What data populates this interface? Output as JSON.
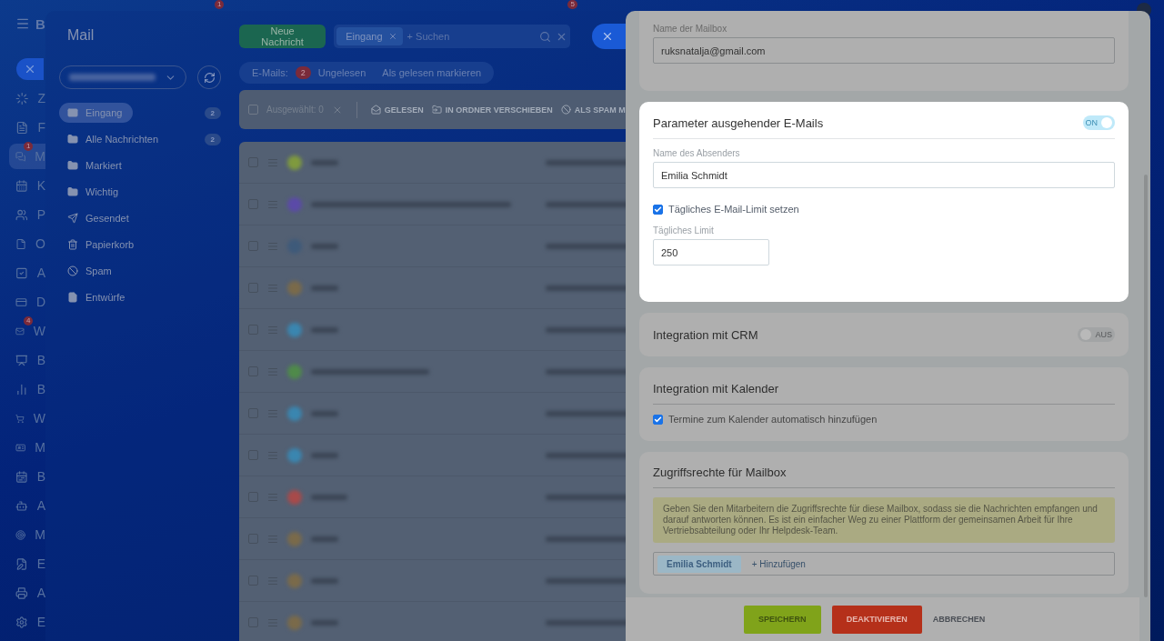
{
  "topbar": {
    "badges": [
      "1",
      "5"
    ]
  },
  "rail": {
    "brand": "B",
    "items": [
      {
        "label": "Z",
        "selected": false
      },
      {
        "label": "F",
        "selected": false
      },
      {
        "label": "M",
        "selected": true,
        "badge": "1"
      },
      {
        "label": "K",
        "selected": false
      },
      {
        "label": "P",
        "selected": false
      },
      {
        "label": "O",
        "selected": false
      },
      {
        "label": "A",
        "selected": false
      },
      {
        "label": "D",
        "selected": false
      },
      {
        "label": "W",
        "selected": false,
        "badge": "4"
      },
      {
        "label": "B",
        "selected": false
      },
      {
        "label": "B",
        "selected": false
      },
      {
        "label": "W",
        "selected": false
      },
      {
        "label": "M",
        "selected": false
      },
      {
        "label": "B",
        "selected": false
      },
      {
        "label": "A",
        "selected": false
      },
      {
        "label": "M",
        "selected": false
      },
      {
        "label": "E",
        "selected": false
      },
      {
        "label": "A",
        "selected": false
      },
      {
        "label": "E",
        "selected": false
      }
    ]
  },
  "mail": {
    "title": "Mail",
    "folders": [
      {
        "label": "Eingang",
        "count": "2",
        "selected": true
      },
      {
        "label": "Alle Nachrichten",
        "count": "2",
        "selected": false
      },
      {
        "label": "Markiert",
        "selected": false
      },
      {
        "label": "Wichtig",
        "selected": false
      },
      {
        "label": "Gesendet",
        "selected": false
      },
      {
        "label": "Papierkorb",
        "selected": false
      },
      {
        "label": "Spam",
        "selected": false
      },
      {
        "label": "Entwürfe",
        "selected": false
      }
    ]
  },
  "toolbar": {
    "new_button": "Neue Nachricht",
    "filter_chip": "Eingang",
    "search_placeholder": "+ Suchen"
  },
  "counter": {
    "label": "E-Mails:",
    "count": "2",
    "unread": "Ungelesen",
    "mark_read": "Als gelesen markieren"
  },
  "actions": {
    "select_all_checked": false,
    "selected": "Ausgewählt: 0",
    "buttons": [
      "GELESEN",
      "IN ORDNER VERSCHIEBEN",
      "ALS SPAM M"
    ]
  },
  "rows": [
    {
      "color": "#7f9a3e",
      "checked": false
    },
    {
      "color": "#5b4aa8",
      "checked": false
    },
    {
      "color": "#3e5a7a",
      "checked": false
    },
    {
      "color": "#7a6a4a",
      "checked": false
    },
    {
      "color": "#3a86b0",
      "checked": false
    },
    {
      "color": "#4f8a4a",
      "checked": false
    },
    {
      "color": "#3a86b0",
      "checked": false
    },
    {
      "color": "#3a86b0",
      "checked": false
    },
    {
      "color": "#a84a4a",
      "checked": false
    },
    {
      "color": "#7a6a4a",
      "checked": false
    },
    {
      "color": "#7a6a4a",
      "checked": false
    },
    {
      "color": "#7a6a4a",
      "checked": false
    }
  ],
  "settings": {
    "mailbox": {
      "label": "Name der Mailbox",
      "value": "ruksnatalja@gmail.com"
    },
    "outgoing": {
      "title": "Parameter ausgehender E-Mails",
      "toggle_on": true,
      "toggle_label": "ON",
      "sender_label": "Name des Absenders",
      "sender_value": "Emilia Schmidt",
      "limit_checkbox": {
        "label": "Tägliches E-Mail-Limit setzen",
        "checked": true
      },
      "limit_label": "Tägliches Limit",
      "limit_value": "250"
    },
    "crm": {
      "title": "Integration mit CRM",
      "toggle_on": false,
      "toggle_label": "AUS"
    },
    "calendar": {
      "title": "Integration mit Kalender",
      "checkbox": {
        "label": "Termine zum Kalender automatisch hinzufügen",
        "checked": true
      }
    },
    "access": {
      "title": "Zugriffsrechte für Mailbox",
      "note": "Geben Sie den Mitarbeitern die Zugriffsrechte für diese Mailbox, sodass sie die Nachrichten empfangen und darauf antworten können. Es ist ein einfacher Weg zu einer Plattform der gemeinsamen Arbeit für Ihre Vertriebsabteilung oder Ihr Helpdesk-Team.",
      "chips": [
        "Emilia Schmidt"
      ],
      "add_label": "+ Hinzufügen"
    },
    "footer": {
      "save": "SPEICHERN",
      "deactivate": "DEAKTIVIEREN",
      "cancel": "ABBRECHEN"
    }
  }
}
